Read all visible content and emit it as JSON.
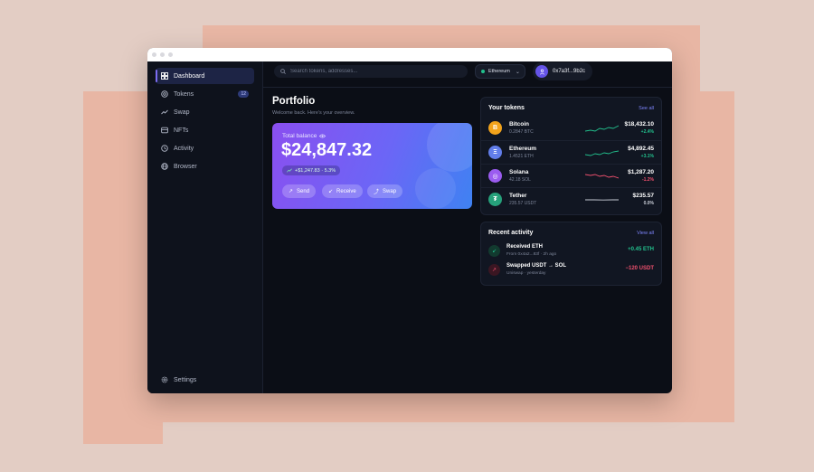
{
  "colors": {
    "accent": "#7c6cf2",
    "positive": "#22c08d",
    "negative": "#f0506e",
    "background": "#0b0e16"
  },
  "sidebar": {
    "items": [
      {
        "label": "Dashboard",
        "icon": "grid-icon",
        "active": true
      },
      {
        "label": "Tokens",
        "icon": "coin-icon",
        "badge": "12"
      },
      {
        "label": "Swap",
        "icon": "trend-icon"
      },
      {
        "label": "NFTs",
        "icon": "image-icon"
      },
      {
        "label": "Activity",
        "icon": "activity-icon"
      },
      {
        "label": "Browser",
        "icon": "globe-icon"
      }
    ],
    "settings": {
      "label": "Settings",
      "icon": "gear-icon"
    }
  },
  "topbar": {
    "search_placeholder": "Search tokens, addresses...",
    "network": "Ethereum",
    "account": "0x7a3f...9b2c"
  },
  "header": {
    "title": "Portfolio",
    "subtitle": "Welcome back. Here's your overview."
  },
  "balance": {
    "label": "Total balance",
    "amount": "$24,847.32",
    "change": "+$1,247.83 · 5.3%",
    "actions": {
      "send": "Send",
      "receive": "Receive",
      "swap": "Swap"
    }
  },
  "tokens": {
    "title": "Your tokens",
    "link": "See all",
    "items": [
      {
        "symbol_glyph": "B",
        "name": "Bitcoin",
        "holding": "0.2847 BTC",
        "value": "$18,432.10",
        "change": "+2.4%",
        "trend": "up",
        "color": "#f2a31b"
      },
      {
        "symbol_glyph": "Ξ",
        "name": "Ethereum",
        "holding": "1.4521 ETH",
        "value": "$4,892.45",
        "change": "+3.1%",
        "trend": "up",
        "color": "#627eea"
      },
      {
        "symbol_glyph": "◎",
        "name": "Solana",
        "holding": "42.18 SOL",
        "value": "$1,287.20",
        "change": "-1.2%",
        "trend": "down",
        "color": "#9b5cf0"
      },
      {
        "symbol_glyph": "₮",
        "name": "Tether",
        "holding": "235.57 USDT",
        "value": "$235.57",
        "change": "0.0%",
        "trend": "flat",
        "color": "#26a17b"
      }
    ]
  },
  "activity": {
    "title": "Recent activity",
    "link": "View all",
    "items": [
      {
        "title": "Received ETH",
        "sub": "From 0x4a2...83f · 2h ago",
        "amount": "+0.45 ETH",
        "direction": "in"
      },
      {
        "title": "Swapped USDT → SOL",
        "sub": "Uniswap · yesterday",
        "amount": "−120 USDT",
        "direction": "out"
      }
    ]
  }
}
